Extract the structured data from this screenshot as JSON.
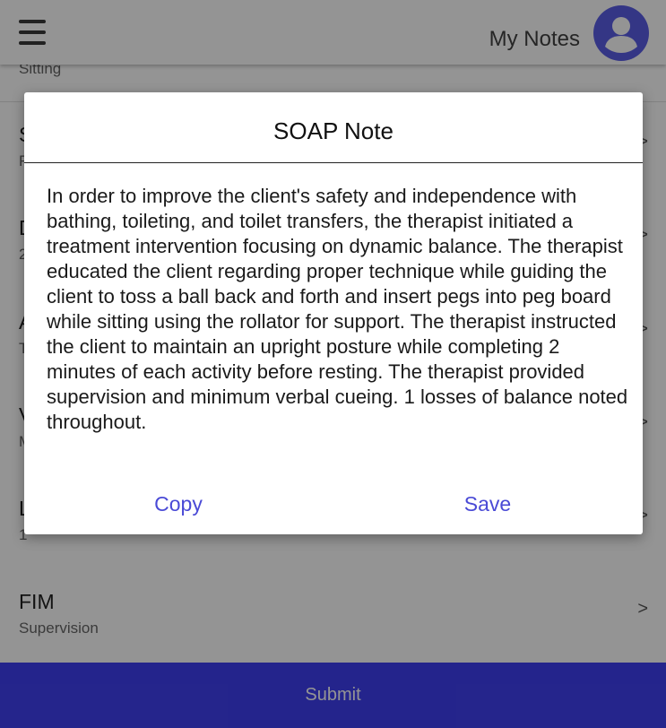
{
  "header": {
    "title": "My Notes",
    "menu_icon": "hamburger-menu-icon",
    "avatar_icon": "account-circle-icon",
    "accent": "#5b5de6"
  },
  "list": {
    "items": [
      {
        "title": "",
        "subtitle": "Sitting"
      },
      {
        "title": "S",
        "subtitle": "F",
        "arrow": ">"
      },
      {
        "title": "D",
        "subtitle": "2",
        "arrow": ">"
      },
      {
        "title": "A",
        "subtitle": "T",
        "arrow": ">"
      },
      {
        "title": "V",
        "subtitle": "M",
        "arrow": ">"
      },
      {
        "title": "L",
        "subtitle": "1",
        "arrow": ">"
      },
      {
        "title": "FIM",
        "subtitle": "Supervision",
        "arrow": ">"
      }
    ]
  },
  "submit": {
    "label": "Submit",
    "color": "#3f3ff2"
  },
  "dialog": {
    "title": "SOAP Note",
    "body": "In order to improve the client's safety and independence with bathing, toileting, and toilet transfers, the therapist initiated a treatment intervention focusing on dynamic balance. The therapist educated the client regarding proper technique while guiding the client to toss a ball back and forth and insert pegs into peg board while sitting using the rollator for support. The therapist instructed the client to maintain an upright posture while completing 2 minutes of each activity before resting. The therapist provided supervision and minimum verbal cueing. 1 losses of balance noted throughout.",
    "copy_label": "Copy",
    "save_label": "Save"
  }
}
